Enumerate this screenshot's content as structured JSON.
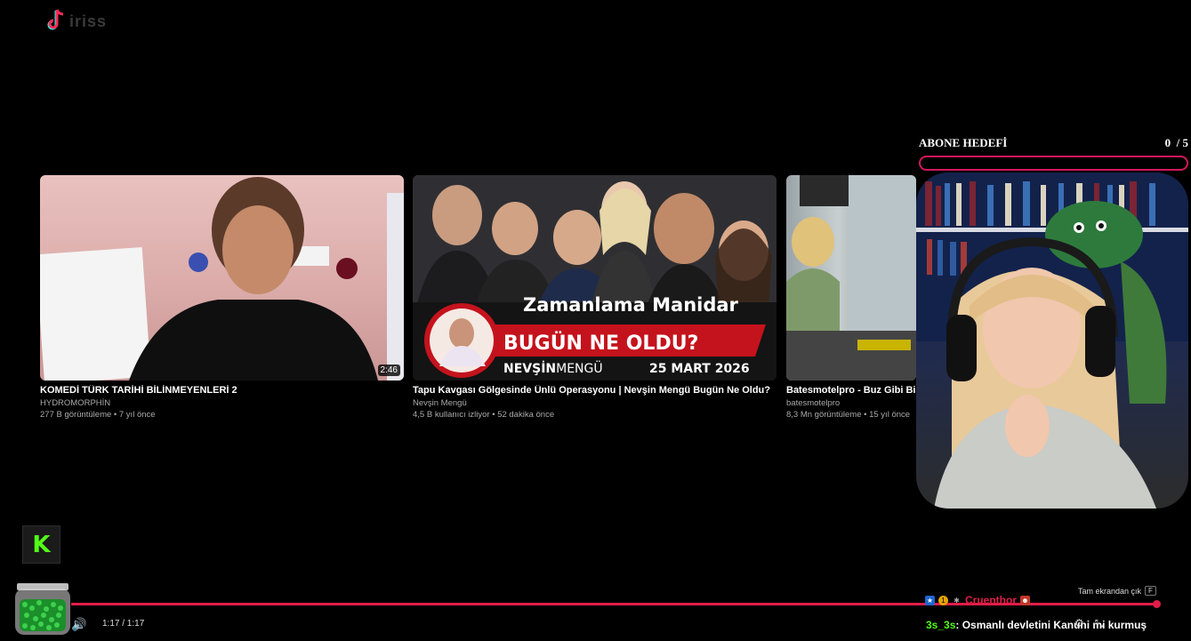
{
  "logo": {
    "text": "iriss"
  },
  "videos": [
    {
      "title": "KOMEDİ TÜRK TARİHİ BİLİNMEYENLERİ 2",
      "channel": "HYDROMORPHİN",
      "meta": "277 B görüntüleme • 7 yıl önce",
      "duration": "2:46"
    },
    {
      "title": "Tapu Kavgası Gölgesinde Ünlü Operasyonu | Nevşin Mengü Bugün Ne Oldu?",
      "channel": "Nevşin Mengü",
      "meta": "4,5 B kullanıcı izliyor • 52 dakika önce",
      "thumb_texts": {
        "headline": "Zamanlama Manidar",
        "banner": "BUGÜN NE OLDU?",
        "brand_bold": "NEVŞİN",
        "brand_light": "MENGÜ",
        "date": "25 MART 2026"
      }
    },
    {
      "title": "Batesmotelpro - Buz Gibi Birad",
      "channel": "batesmotelpro",
      "meta": "8,3 Mn görüntüleme • 15 yıl önce"
    }
  ],
  "goal": {
    "label": "ABONE HEDEFİ",
    "count": "0",
    "total": "/ 5",
    "progress": 0
  },
  "player": {
    "time": "1:17 / 1:17",
    "progress": 1.0,
    "fullscreen_hint": "Tam ekrandan çık",
    "fullscreen_key": "F"
  },
  "chat": [
    {
      "user": "Cruenthor",
      "text": ""
    },
    {
      "user": "3s_3s",
      "text": ": Osmanlı devletini Kanuni mi kurmuş"
    }
  ],
  "kick_logo": "K",
  "colors": {
    "accent": "#e11d48",
    "kick": "#53fc18",
    "goal_border": "#d2175c"
  }
}
